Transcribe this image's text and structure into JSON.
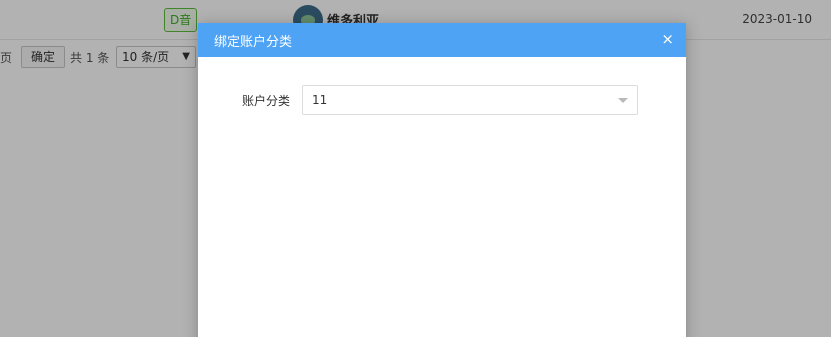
{
  "background": {
    "row": {
      "tag": "D音",
      "user_name": "维多利亚",
      "date": "2023-01-10"
    },
    "pager": {
      "page_suffix": "页",
      "confirm_label": "确定",
      "total_text": "共 1 条",
      "page_size_value": "10 条/页",
      "page_size_arrow": "▼"
    }
  },
  "dialog": {
    "title": "绑定账户分类",
    "close_label": "×",
    "form": {
      "label": "账户分类",
      "selected_value": "11"
    }
  },
  "colors": {
    "header_bg": "#4fa3f5",
    "tag_green": "#3fae28",
    "overlay": "rgba(0,0,0,0.30)"
  }
}
